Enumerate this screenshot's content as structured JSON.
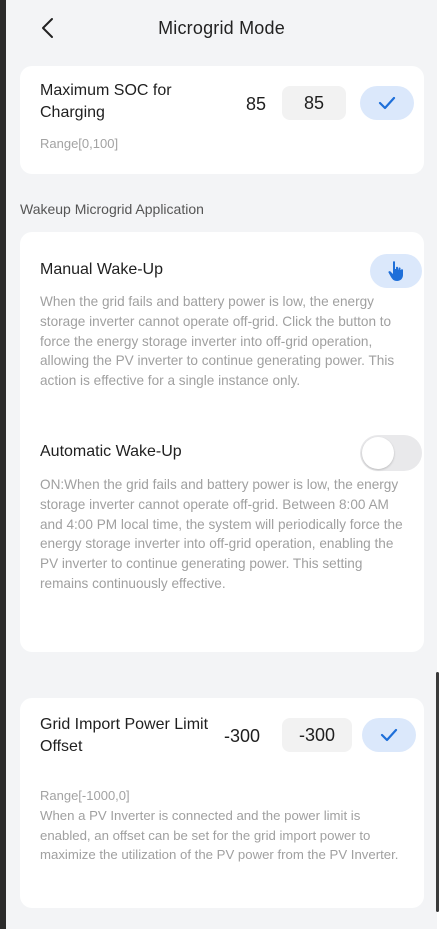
{
  "header": {
    "title": "Microgrid Mode",
    "back_icon": "chevron-left-icon"
  },
  "soc": {
    "label": "Maximum SOC for Charging",
    "range": "Range[0,100]",
    "current_value": "85",
    "input_value": "85",
    "confirm_icon": "check-icon"
  },
  "section": {
    "title": "Wakeup Microgrid Application"
  },
  "manual": {
    "title": "Manual Wake-Up",
    "description": "When the grid fails and battery power is low, the energy storage inverter cannot operate off-grid. Click the button to force the energy storage inverter into off-grid operation, allowing the PV inverter to continue generating power. This action is effective for a single instance only.",
    "button_icon": "hand-pointer-icon"
  },
  "automatic": {
    "title": "Automatic Wake-Up",
    "description": "ON:When the grid fails and battery power is low, the energy storage inverter cannot operate off-grid. Between 8:00 AM and 4:00 PM local time, the system will periodically force the energy storage inverter into off-grid operation, enabling the PV inverter to continue generating power. This setting remains continuously effective.",
    "enabled": false
  },
  "grid": {
    "label": "Grid Import Power Limit Offset",
    "current_value": "-300",
    "input_value": "-300",
    "range": "Range[-1000,0]",
    "description": "When a PV Inverter is connected and the power limit is enabled, an offset can be set for the grid import power to maximize the utilization of the PV power from the PV Inverter.",
    "confirm_icon": "check-icon"
  },
  "colors": {
    "accent": "#1e6fd9",
    "accent_bg": "#dbe8fb",
    "background": "#f3f4f6",
    "card": "#ffffff"
  }
}
